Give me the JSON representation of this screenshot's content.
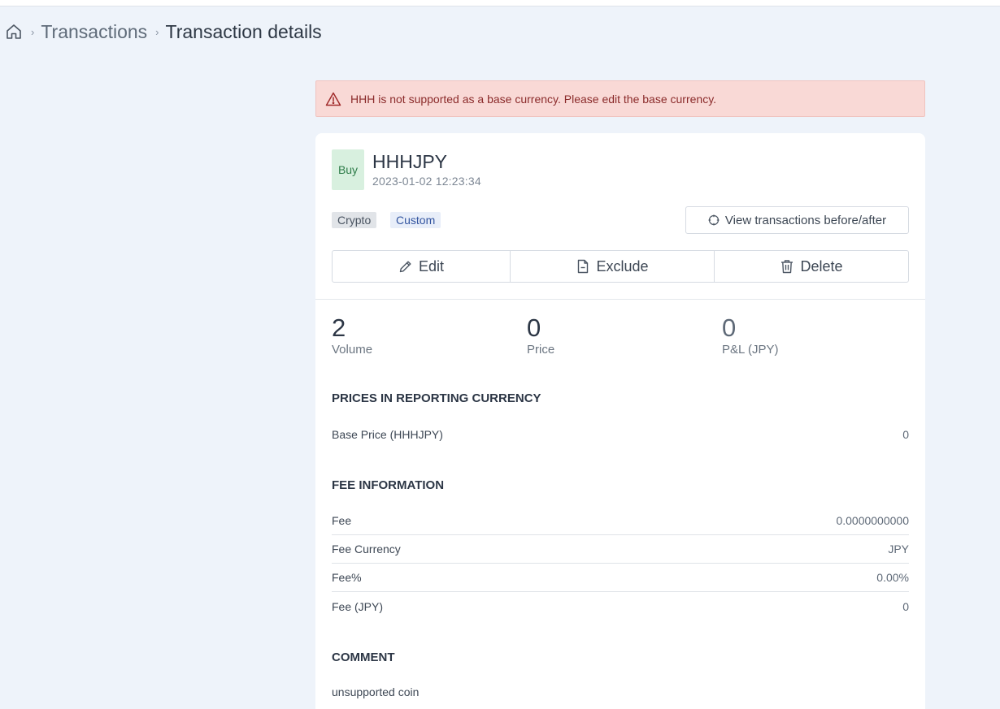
{
  "breadcrumb": {
    "home_icon": "home-icon",
    "items": [
      "Transactions",
      "Transaction details"
    ]
  },
  "alert": {
    "icon": "warning-triangle-icon",
    "text": "HHH is not supported as a base currency. Please edit the base currency."
  },
  "transaction": {
    "side": "Buy",
    "pair": "HHHJPY",
    "datetime": "2023-01-02 12:23:34",
    "tags": [
      "Crypto",
      "Custom"
    ],
    "view_button": "View transactions before/after"
  },
  "actions": {
    "edit": "Edit",
    "exclude": "Exclude",
    "delete": "Delete"
  },
  "stats": [
    {
      "value": "2",
      "label": "Volume"
    },
    {
      "value": "0",
      "label": "Price"
    },
    {
      "value": "0",
      "label": "P&L (JPY)"
    }
  ],
  "prices": {
    "title": "PRICES IN REPORTING CURRENCY",
    "rows": [
      {
        "label": "Base Price (HHHJPY)",
        "value": "0"
      }
    ]
  },
  "fees": {
    "title": "FEE INFORMATION",
    "rows": [
      {
        "label": "Fee",
        "value": "0.0000000000"
      },
      {
        "label": "Fee Currency",
        "value": "JPY"
      },
      {
        "label": "Fee%",
        "value": "0.00%"
      },
      {
        "label": "Fee (JPY)",
        "value": "0"
      }
    ]
  },
  "comment": {
    "title": "COMMENT",
    "text": "unsupported coin"
  },
  "colors": {
    "background": "#eef3fa",
    "alert_bg": "#f9d9d6",
    "alert_text": "#8b2b2b",
    "buy_bg": "#d8f0df",
    "buy_text": "#2f7d4a"
  }
}
